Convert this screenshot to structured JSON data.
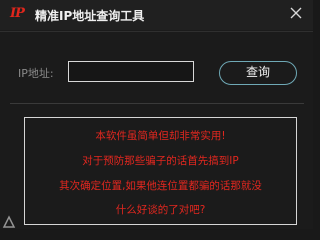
{
  "window": {
    "logo_text": "IP",
    "title": "精准IP地址查询工具",
    "close_icon": "close-icon"
  },
  "form": {
    "ip_label": "IP地址:",
    "ip_value": "",
    "query_label": "查询"
  },
  "result": {
    "lines": [
      "本软件虽简单但却非常实用!",
      "对于预防那些骗子的话首先搞到IP",
      "其次确定位置,如果他连位置都骗的话那就没",
      "什么好谈的了对吧?"
    ]
  },
  "colors": {
    "accent_red": "#e2271f",
    "button_border": "#6fa9b6",
    "background": "#1b1b1b"
  }
}
